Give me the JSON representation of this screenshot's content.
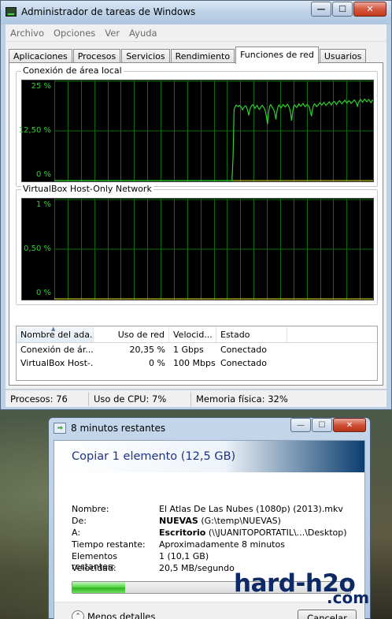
{
  "task_manager": {
    "title": "Administrador de tareas de Windows",
    "caption_buttons": {
      "minimize": "—",
      "maximize": "☐",
      "close": "✕"
    },
    "menu": [
      "Archivo",
      "Opciones",
      "Ver",
      "Ayuda"
    ],
    "tabs": [
      "Aplicaciones",
      "Procesos",
      "Servicios",
      "Rendimiento",
      "Funciones de red",
      "Usuarios"
    ],
    "active_tab": "Funciones de red",
    "graph_color": "#2fd02f",
    "graphs": [
      {
        "label": "Conexión de área local",
        "y_labels": [
          "25 %",
          "12,50 %",
          "0 %"
        ],
        "y_max": 25,
        "samples": [
          0,
          0,
          0,
          0,
          0,
          0,
          0,
          0,
          0,
          0,
          0,
          0,
          0,
          0,
          0,
          0,
          0,
          0,
          0,
          0,
          0,
          0,
          0,
          0,
          0,
          0,
          0,
          0,
          0,
          0,
          0,
          0,
          0,
          0,
          0,
          0,
          0,
          0,
          0,
          0,
          0,
          0,
          0,
          0,
          0,
          0,
          0,
          0,
          0,
          0,
          0,
          0,
          0,
          0,
          0,
          0,
          0,
          0,
          0,
          0,
          0,
          0,
          0,
          0,
          0,
          0,
          0,
          0,
          0,
          0,
          0,
          0,
          0,
          0,
          0,
          0,
          0,
          0,
          0,
          0,
          0,
          0,
          0,
          0,
          0,
          0,
          0,
          0,
          0,
          0,
          0,
          0,
          0,
          0,
          0,
          0,
          0,
          0,
          0,
          0,
          0,
          0,
          0,
          0,
          0,
          0,
          0,
          0,
          0,
          0,
          0,
          0,
          0,
          0,
          0,
          0,
          0,
          0,
          0,
          0,
          0,
          0,
          0,
          0,
          0,
          0,
          0,
          0,
          0,
          0,
          0,
          0,
          0,
          0,
          0,
          0,
          0,
          0,
          0,
          0,
          0,
          0,
          0,
          0,
          0,
          0,
          0,
          0,
          0,
          0,
          0,
          0,
          0,
          0,
          0,
          0,
          0,
          0,
          0,
          0,
          0,
          0,
          0,
          0,
          0,
          0,
          0,
          0,
          0,
          0,
          0,
          6,
          18,
          18.5,
          19,
          18.8,
          18.6,
          18.9,
          18.7,
          18.5,
          17.8,
          18.2,
          18.6,
          18.8,
          18.4,
          17.6,
          16.4,
          17.8,
          18.5,
          18.9,
          19.1,
          18.7,
          18.2,
          18.6,
          18.9,
          18.4,
          17.9,
          18.2,
          18.7,
          18.9,
          18.5,
          18.1,
          17.4,
          15.8,
          14.2,
          17.2,
          18.6,
          19.1,
          18.7,
          18.2,
          17.8,
          16.9,
          15.4,
          17.4,
          18.6,
          19.0,
          18.6,
          18.3,
          18.8,
          19.1,
          18.8,
          18.5,
          18.9,
          19.2,
          18.8,
          18.2,
          17.1,
          15.1,
          17.3,
          18.7,
          19.0,
          18.6,
          18.4,
          18.8,
          19.3,
          18.9,
          18.7,
          19.1,
          19.4,
          18.9,
          18.6,
          18.9,
          19.2,
          18.8,
          18.5,
          17.3,
          16.2,
          18.0,
          18.9,
          19.3,
          19.0,
          18.6,
          18.9,
          19.2,
          19.6,
          19.3,
          19.0,
          19.4,
          19.7,
          19.3,
          18.9,
          19.2,
          19.5,
          19.8,
          19.4,
          19.0,
          19.5,
          19.8,
          19.9,
          19.5,
          19.1,
          19.6,
          19.9,
          20.1,
          19.7,
          19.3,
          19.6,
          19.9,
          20.2,
          19.8,
          19.5,
          19.9,
          20.1,
          19.8,
          19.4,
          19.7,
          20.0,
          20.3,
          19.9,
          19.5,
          18.7,
          19.6,
          20.1,
          20.4,
          20.0,
          19.7,
          20.2,
          20.5,
          20.1,
          19.8,
          20.2,
          20.4,
          20.0,
          19.6,
          20.1,
          20.3
        ]
      },
      {
        "label": "VirtualBox Host-Only Network",
        "y_labels": [
          "1 %",
          "0,50 %",
          "0 %"
        ],
        "y_max": 1,
        "samples": []
      }
    ],
    "columns": [
      "Nombre del ada...",
      "Uso de red",
      "Velocid...",
      "Estado"
    ],
    "rows": [
      [
        "Conexión de ár...",
        "20,35 %",
        "1 Gbps",
        "Conectado"
      ],
      [
        "VirtualBox Host-...",
        "0 %",
        "100 Mbps",
        "Conectado"
      ]
    ],
    "status": {
      "processes": "Procesos: 76",
      "cpu": "Uso de CPU: 7%",
      "memory": "Memoria física: 32%"
    }
  },
  "copy_dialog": {
    "title": "8 minutos restantes",
    "heading": "Copiar 1 elemento (12,5 GB)",
    "details": [
      {
        "key": "Nombre:",
        "value": "El Atlas De Las Nubes (1080p) (2013).mkv"
      },
      {
        "key": "De:",
        "bold": "NUEVAS",
        "value": " (G:\\temp\\NUEVAS)"
      },
      {
        "key": "A:",
        "bold": "Escritorio",
        "value": " (\\\\JUANITOPORTATIL\\...\\Desktop)"
      },
      {
        "key": "Tiempo restante:",
        "value": "Aproximadamente 8 minutos"
      },
      {
        "key": "Elementos restantes:",
        "value": "1 (10,1 GB)"
      },
      {
        "key": "Velocidad:",
        "value": "20,5 MB/segundo"
      }
    ],
    "progress_fraction": 0.19,
    "toggle_label": "Menos detalles",
    "cancel_label": "Cancelar"
  },
  "watermark": {
    "line1": "hard-h2o",
    "line2": ".com"
  }
}
